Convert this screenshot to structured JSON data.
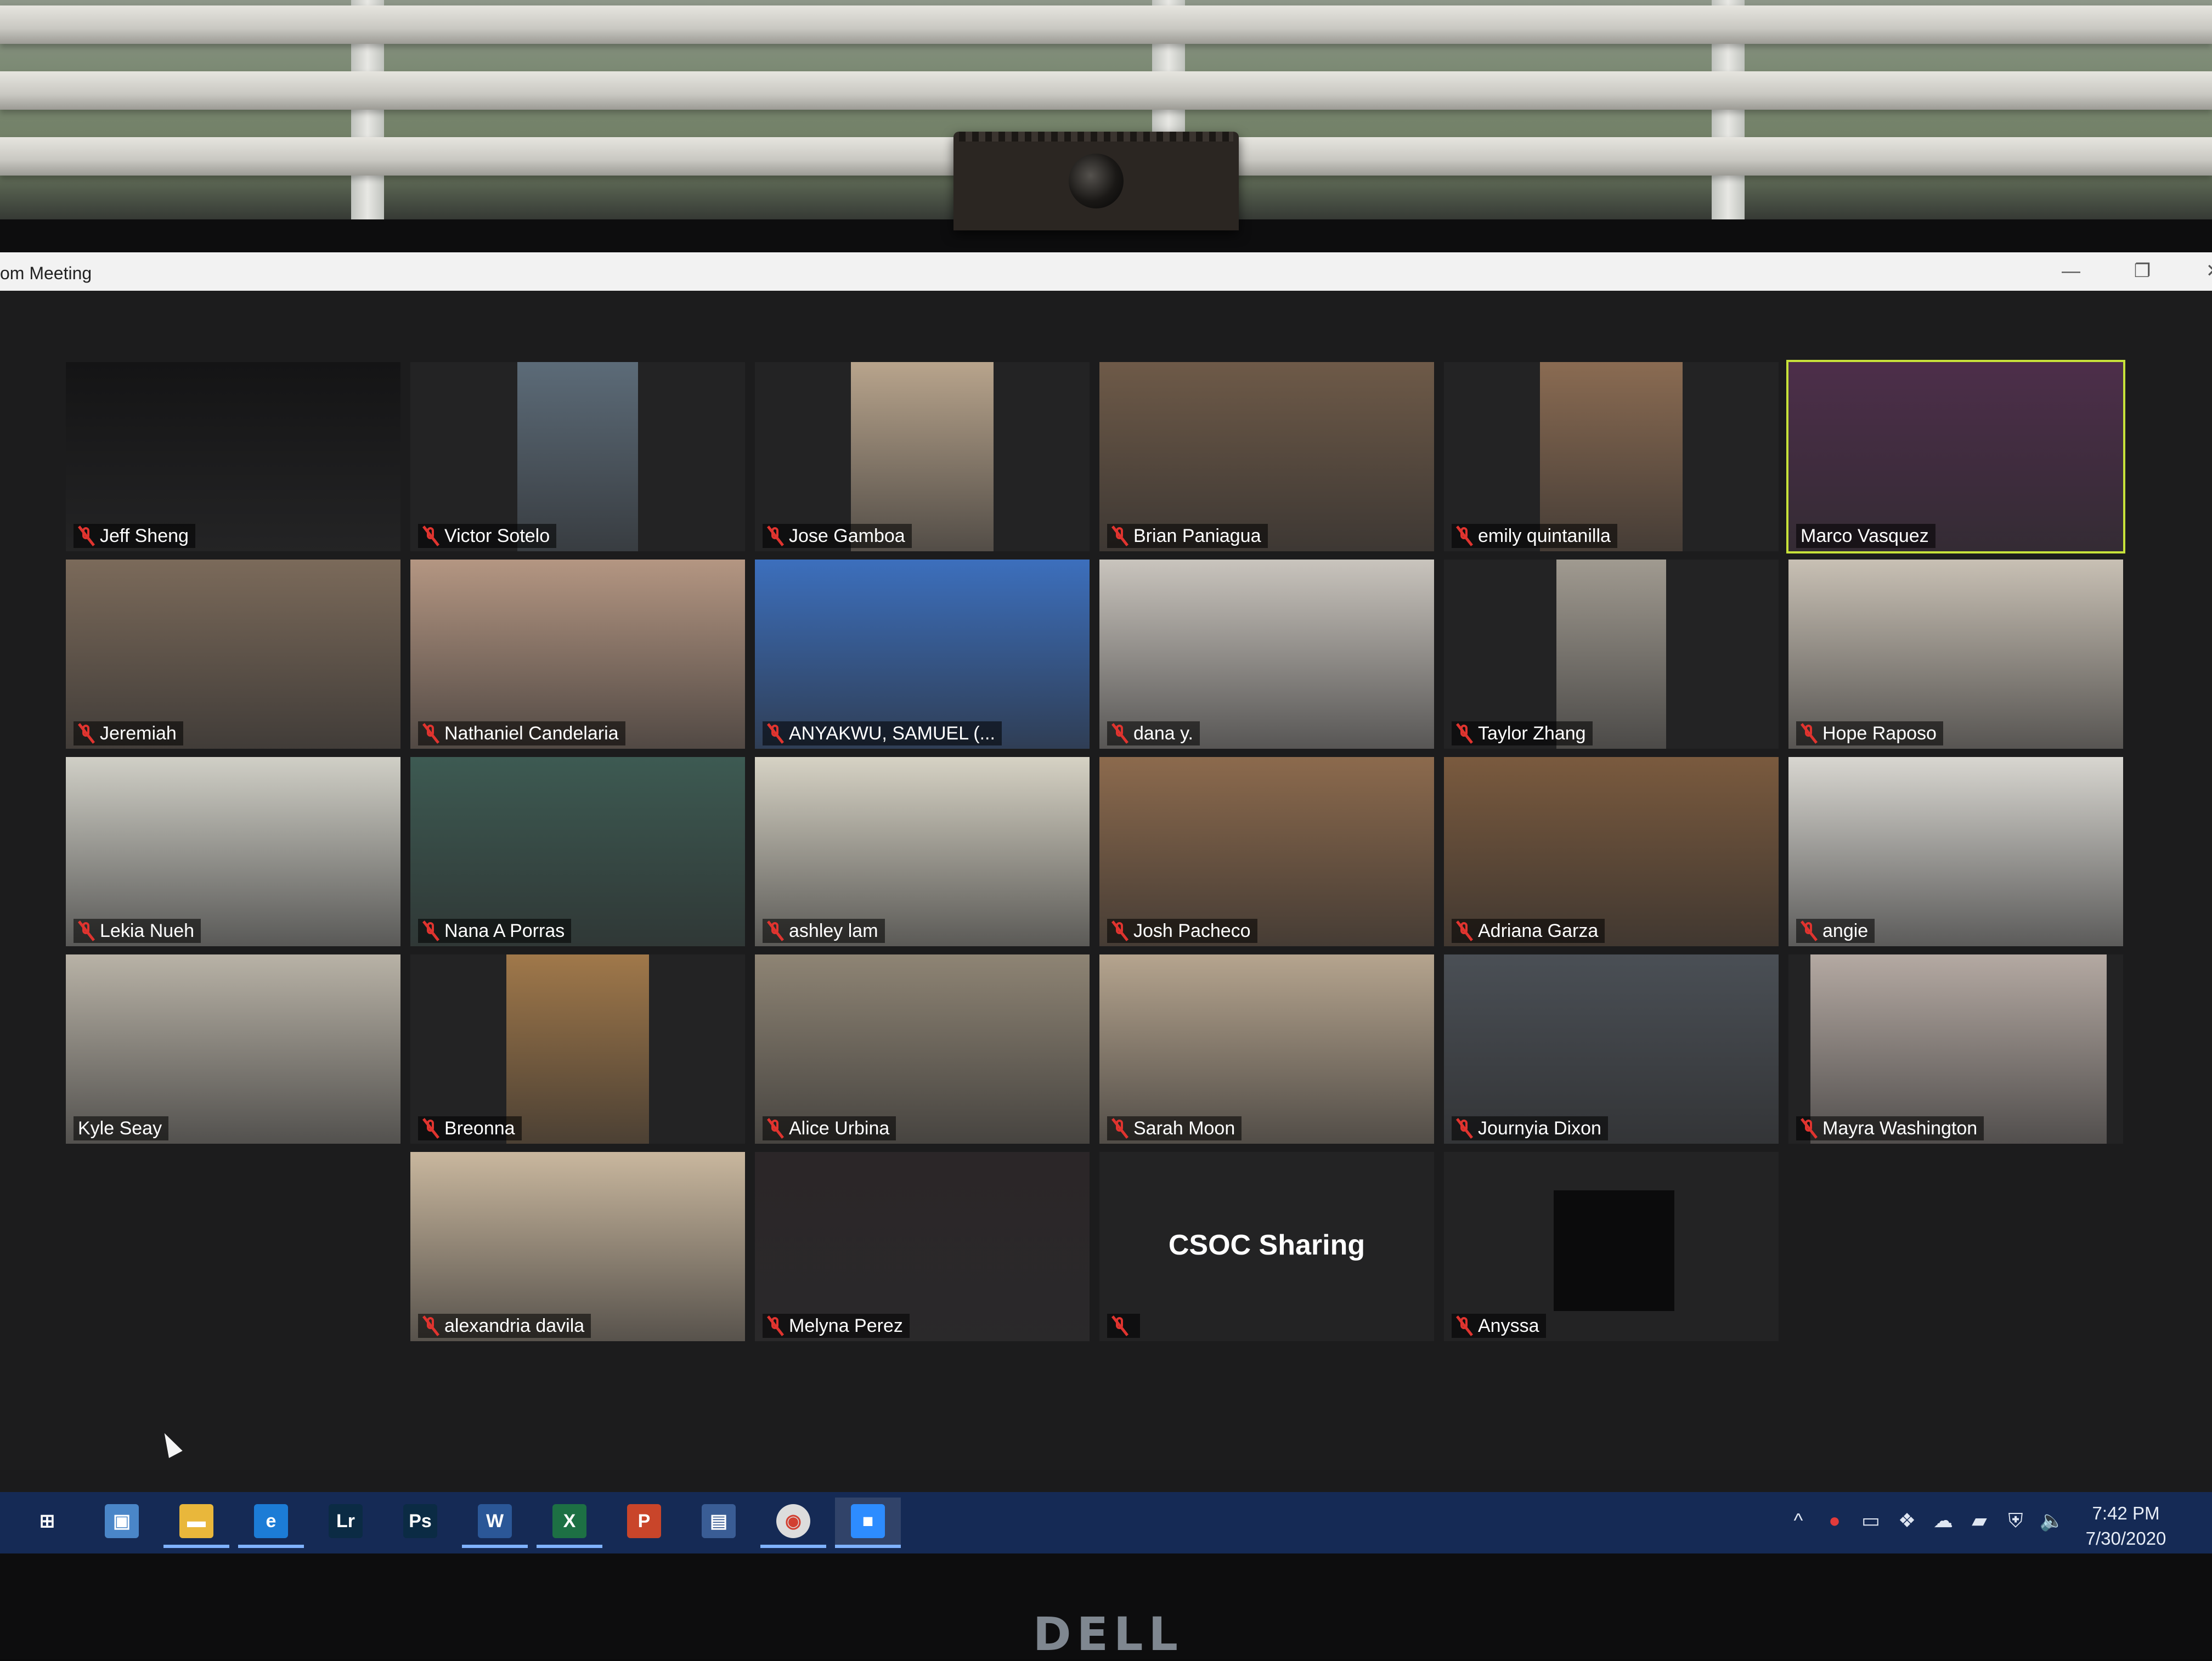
{
  "window": {
    "title": "om Meeting",
    "minimize": "—",
    "restore": "❐",
    "close": "✕"
  },
  "participants": [
    {
      "name": "Jeff Sheng",
      "muted": true,
      "video_color": "#141415"
    },
    {
      "name": "Victor Sotelo",
      "muted": true,
      "video_color": "#5c6b78"
    },
    {
      "name": "Jose Gamboa",
      "muted": true,
      "video_color": "#b8a48c"
    },
    {
      "name": "Brian Paniagua",
      "muted": true,
      "video_color": "#6e5a48"
    },
    {
      "name": "emily quintanilla",
      "muted": true,
      "video_color": "#8a6b52"
    },
    {
      "name": "Marco Vasquez",
      "muted": false,
      "active_speaker": true,
      "video_color": "#4d2e4a"
    },
    {
      "name": "Jeremiah",
      "muted": true,
      "video_color": "#7b6a5a"
    },
    {
      "name": "Nathaniel Candelaria",
      "muted": true,
      "video_color": "#b49682"
    },
    {
      "name": "ANYAKWU, SAMUEL (...",
      "muted": true,
      "video_color": "#3c6fbd"
    },
    {
      "name": "dana y.",
      "muted": true,
      "video_color": "#c9c4bd"
    },
    {
      "name": "Taylor Zhang",
      "muted": true,
      "video_color": "#a09a90"
    },
    {
      "name": "Hope Raposo",
      "muted": true,
      "video_color": "#c8c0b4"
    },
    {
      "name": "Lekia Nueh",
      "muted": true,
      "video_color": "#d0cfc6"
    },
    {
      "name": "Nana A Porras",
      "muted": true,
      "video_color": "#3d5a52"
    },
    {
      "name": "ashley lam",
      "muted": true,
      "video_color": "#d6d2c4"
    },
    {
      "name": "Josh Pacheco",
      "muted": true,
      "video_color": "#8c6a4d"
    },
    {
      "name": "Adriana Garza",
      "muted": true,
      "video_color": "#7a5a3e"
    },
    {
      "name": "angie",
      "muted": true,
      "video_color": "#d8d6d0"
    },
    {
      "name": "Kyle Seay",
      "muted": false,
      "video_color": "#b8b2a6"
    },
    {
      "name": "Breonna",
      "muted": true,
      "video_color": "#a0784a"
    },
    {
      "name": "Alice Urbina",
      "muted": true,
      "video_color": "#8e8474"
    },
    {
      "name": "Sarah Moon",
      "muted": true,
      "video_color": "#b5a48e"
    },
    {
      "name": "Journyia Dixon",
      "muted": true,
      "video_color": "#4a4f55"
    },
    {
      "name": "Mayra Washington",
      "muted": true,
      "video_color": "#b4a9a2"
    },
    {
      "name": "alexandria davila",
      "muted": true,
      "video_color": "#c9b79e"
    },
    {
      "name": "Melyna Perez",
      "muted": true,
      "video_color": "#2b2628"
    },
    {
      "name": "",
      "muted": true,
      "video_off": true,
      "screen_label": "CSOC Sharing"
    },
    {
      "name": "Anyssa",
      "muted": true,
      "video_off": true,
      "placeholder_square": true
    }
  ],
  "taskbar": {
    "apps": [
      {
        "icon": "task-view-icon",
        "glyph": "⊞"
      },
      {
        "icon": "computer-icon",
        "glyph": "▣"
      },
      {
        "icon": "file-explorer-icon",
        "glyph": "▬",
        "running": true
      },
      {
        "icon": "edge-icon",
        "glyph": "e",
        "running": true
      },
      {
        "icon": "lightroom-icon",
        "glyph": "Lr"
      },
      {
        "icon": "photoshop-icon",
        "glyph": "Ps"
      },
      {
        "icon": "word-icon",
        "glyph": "W",
        "running": true
      },
      {
        "icon": "excel-icon",
        "glyph": "X",
        "running": true
      },
      {
        "icon": "powerpoint-icon",
        "glyph": "P"
      },
      {
        "icon": "scanner-app-icon",
        "glyph": "▤"
      },
      {
        "icon": "chrome-icon",
        "glyph": "◉",
        "running": true
      },
      {
        "icon": "zoom-icon",
        "glyph": "■",
        "running": true,
        "current": true
      }
    ],
    "tray": [
      {
        "icon": "chevron-up-icon",
        "glyph": "^"
      },
      {
        "icon": "record-icon",
        "glyph": "●"
      },
      {
        "icon": "display-icon",
        "glyph": "▭"
      },
      {
        "icon": "dropbox-icon",
        "glyph": "❖"
      },
      {
        "icon": "cloud-icon",
        "glyph": "☁"
      },
      {
        "icon": "battery-icon",
        "glyph": "▰"
      },
      {
        "icon": "shield-icon",
        "glyph": "⛨"
      },
      {
        "icon": "volume-icon",
        "glyph": "🔈"
      }
    ],
    "time": "7:42 PM",
    "date": "7/30/2020"
  },
  "monitor_brand": "DELL"
}
